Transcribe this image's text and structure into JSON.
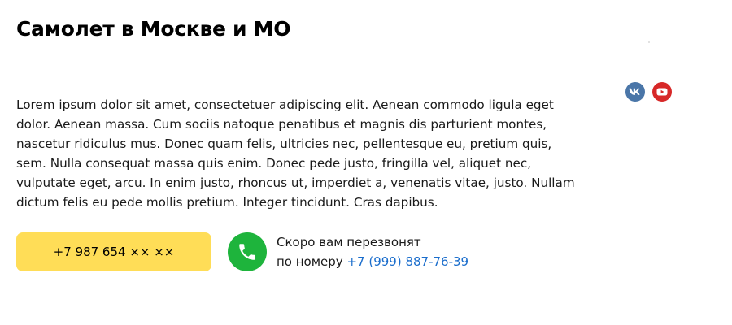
{
  "page": {
    "title": "Самолет в Москве и МО",
    "description": "Lorem ipsum dolor sit amet, consectetuer adipiscing elit. Aenean commodo ligula eget dolor. Aenean massa. Cum sociis natoque penatibus et magnis dis parturient montes, nascetur ridiculus mus. Donec quam felis, ultricies nec, pellentesque eu, pretium quis, sem. Nulla consequat massa quis enim. Donec pede justo, fringilla vel, aliquet nec, vulputate eget, arcu. In enim justo, rhoncus ut, imperdiet a, venenatis vitae, justo. Nullam dictum felis eu pede mollis pretium. Integer tincidunt. Cras dapibus."
  },
  "socials": [
    {
      "name": "vk",
      "icon": "vk-icon",
      "color": "#4a76a8"
    },
    {
      "name": "youtube",
      "icon": "youtube-icon",
      "color": "#d72828"
    }
  ],
  "contact": {
    "phone_button_label": "+7 987 654 ×× ××",
    "phone_button_color": "#ffdd57",
    "call_icon": "phone-icon",
    "call_icon_color": "#1eb43c",
    "callback_line1": "Скоро вам перезвонят",
    "callback_prefix": "по номеру",
    "callback_number": "+7 (999) 887-76-39",
    "link_color": "#1a6dcc"
  }
}
